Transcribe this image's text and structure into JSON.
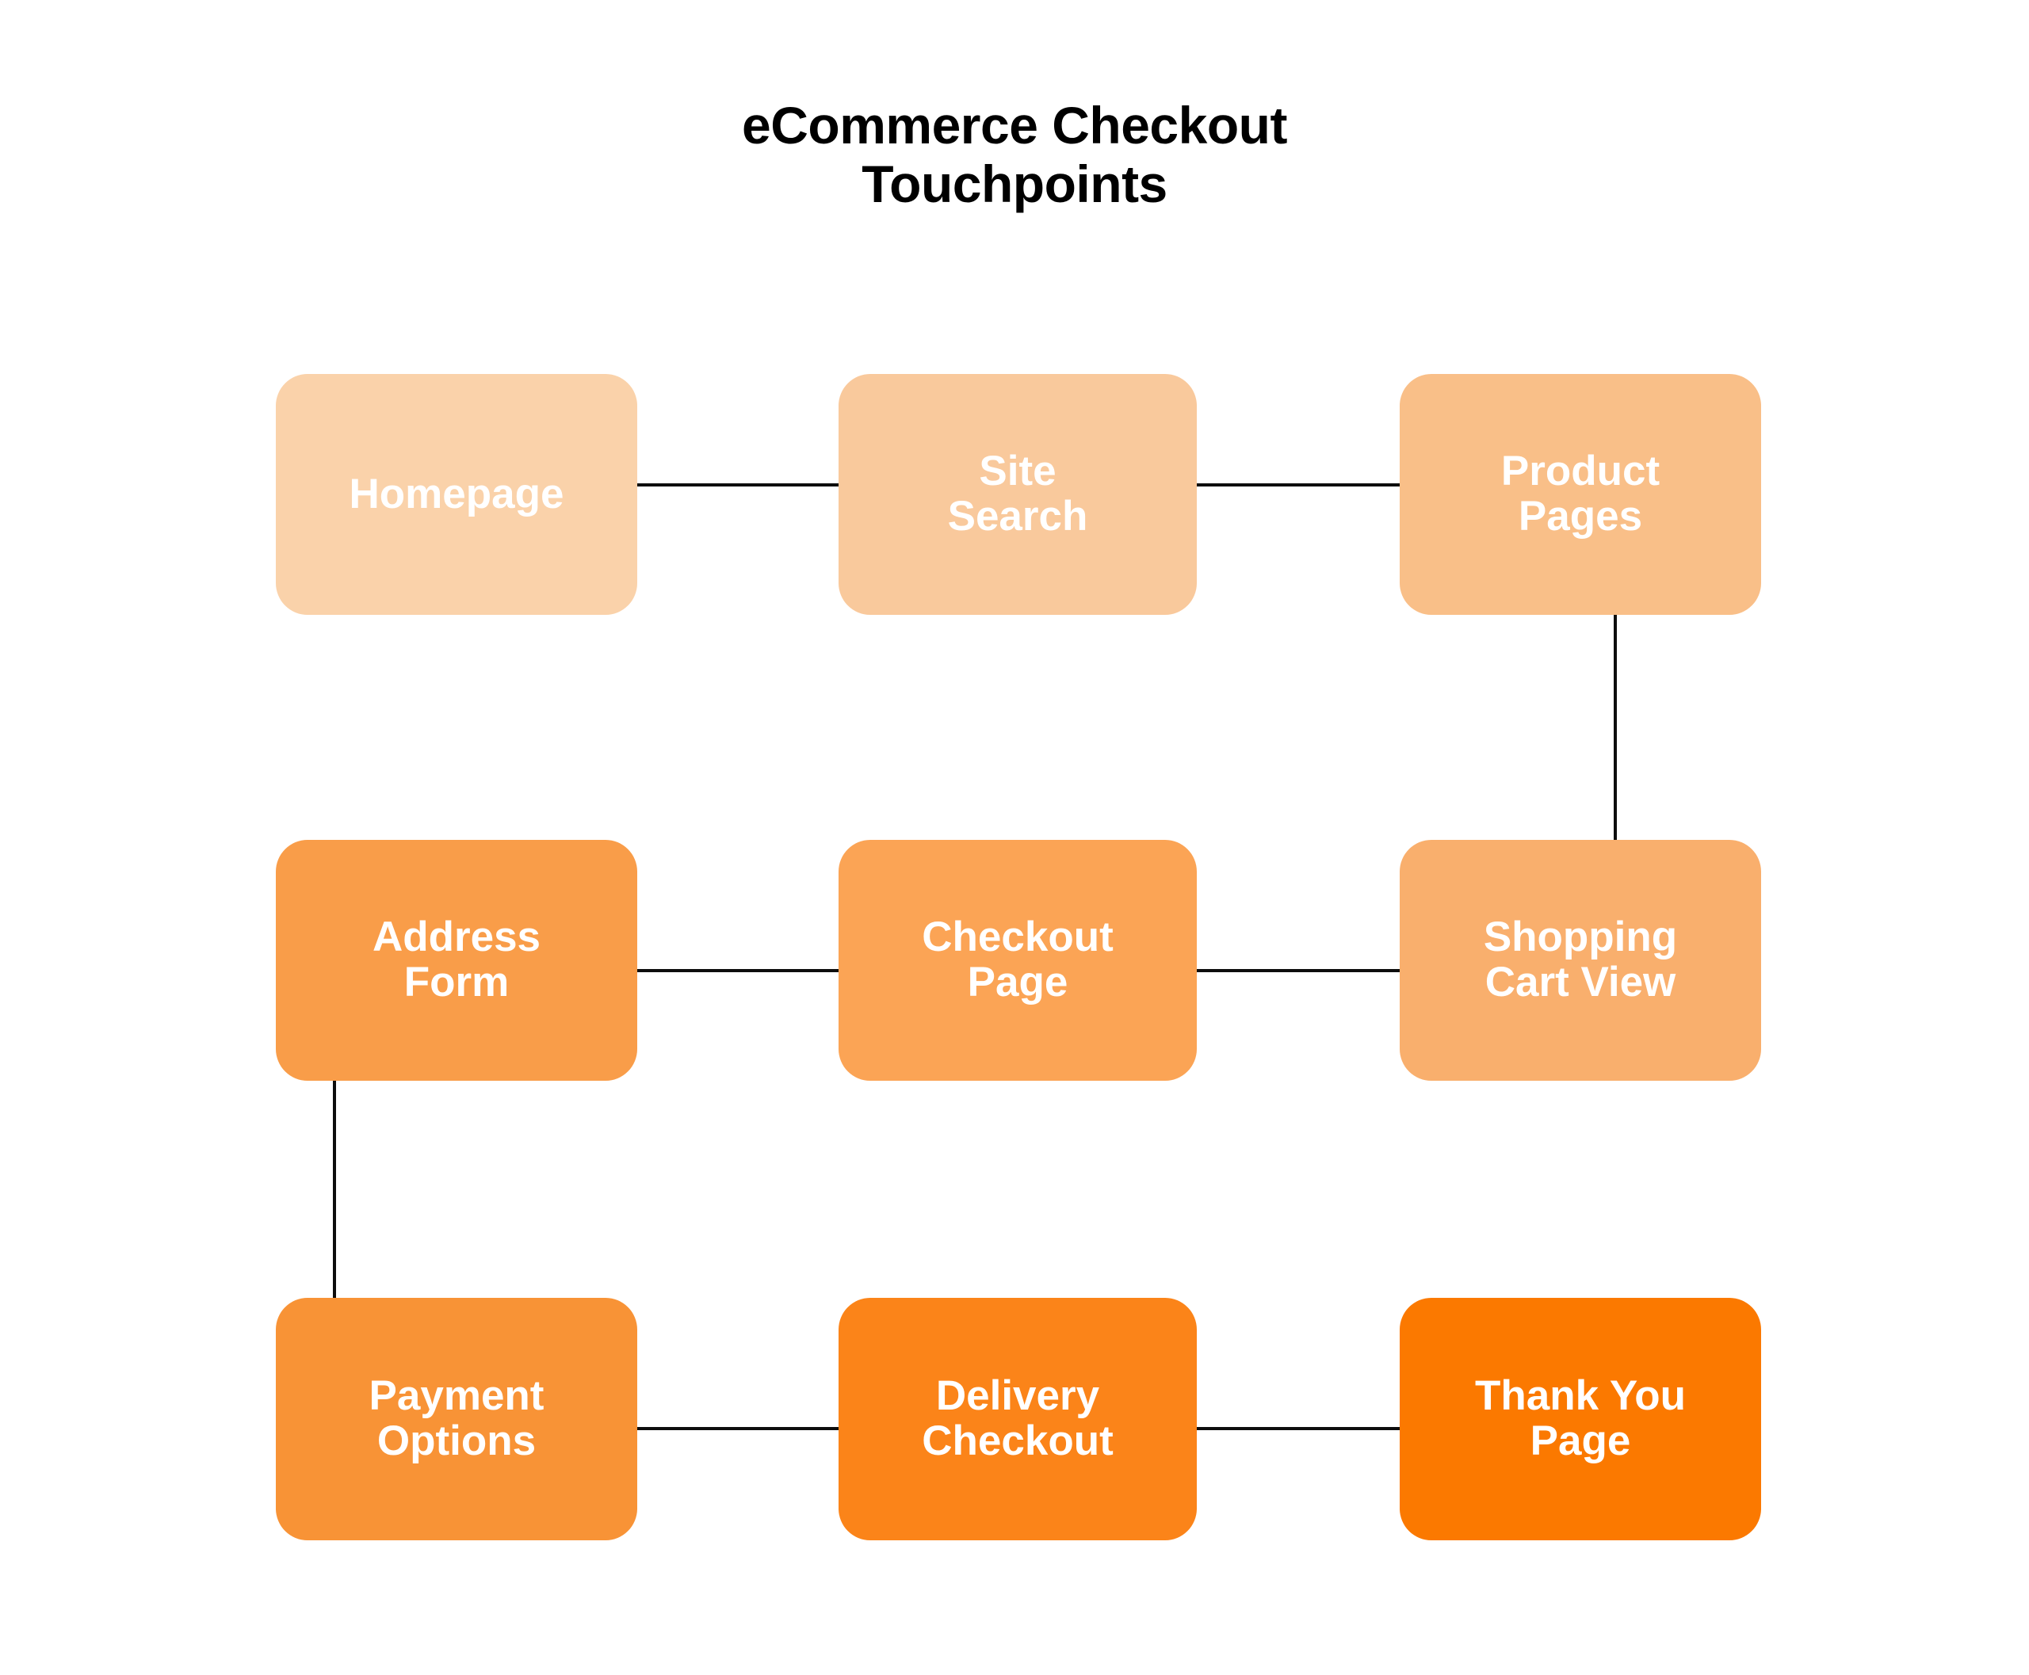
{
  "title": {
    "line1": "eCommerce Checkout",
    "line2": "Touchpoints"
  },
  "colors": {
    "background": "#ffffff",
    "connector": "#0d0d0d",
    "title_text": "#000000",
    "node_text": "#ffffff",
    "homepage": "#fad2aa",
    "site_search": "#f9c99c",
    "product_pages": "#f9bf88",
    "address_form": "#f99d49",
    "checkout_page": "#fba455",
    "shopping_cart_view": "#f9af6d",
    "payment_options": "#f89336",
    "delivery_checkout": "#fb8419",
    "thank_you_page": "#fb7900"
  },
  "nodes": [
    {
      "id": "homepage",
      "label": "Homepage",
      "color": "#fad2aa",
      "row": 1,
      "col": 1
    },
    {
      "id": "site-search",
      "label": "Site\nSearch",
      "color": "#f9c99c",
      "row": 1,
      "col": 2
    },
    {
      "id": "product-pages",
      "label": "Product\nPages",
      "color": "#f9bf88",
      "row": 1,
      "col": 3
    },
    {
      "id": "address-form",
      "label": "Address\nForm",
      "color": "#f99d49",
      "row": 2,
      "col": 1
    },
    {
      "id": "checkout-page",
      "label": "Checkout\nPage",
      "color": "#fba455",
      "row": 2,
      "col": 2
    },
    {
      "id": "shopping-cart-view",
      "label": "Shopping\nCart View",
      "color": "#f9af6d",
      "row": 2,
      "col": 3
    },
    {
      "id": "payment-options",
      "label": "Payment\nOptions",
      "color": "#f89336",
      "row": 3,
      "col": 1
    },
    {
      "id": "delivery-checkout",
      "label": "Delivery\nCheckout",
      "color": "#fb8419",
      "row": 3,
      "col": 2
    },
    {
      "id": "thank-you-page",
      "label": "Thank You\nPage",
      "color": "#fb7900",
      "row": 3,
      "col": 3
    }
  ],
  "connectors": [
    {
      "id": "homepage-to-site-search",
      "from": "homepage",
      "to": "site-search",
      "orientation": "horizontal"
    },
    {
      "id": "site-search-to-product-pages",
      "from": "site-search",
      "to": "product-pages",
      "orientation": "horizontal"
    },
    {
      "id": "product-pages-to-shopping-cart-view",
      "from": "product-pages",
      "to": "shopping-cart-view",
      "orientation": "vertical"
    },
    {
      "id": "shopping-cart-view-to-checkout-page",
      "from": "shopping-cart-view",
      "to": "checkout-page",
      "orientation": "horizontal"
    },
    {
      "id": "checkout-page-to-address-form",
      "from": "checkout-page",
      "to": "address-form",
      "orientation": "horizontal"
    },
    {
      "id": "address-form-to-payment-options",
      "from": "address-form",
      "to": "payment-options",
      "orientation": "vertical"
    },
    {
      "id": "payment-options-to-delivery-checkout",
      "from": "payment-options",
      "to": "delivery-checkout",
      "orientation": "horizontal"
    },
    {
      "id": "delivery-checkout-to-thank-you-page",
      "from": "delivery-checkout",
      "to": "thank-you-page",
      "orientation": "horizontal"
    }
  ]
}
